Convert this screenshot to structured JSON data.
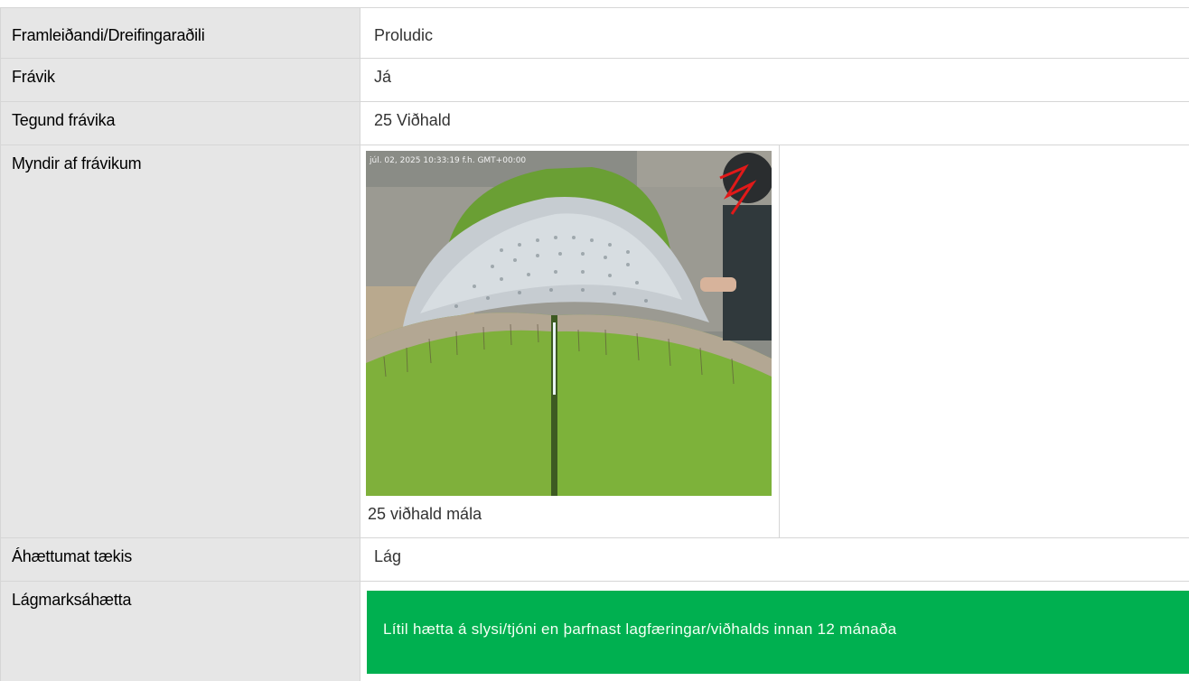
{
  "rows": {
    "manufacturer": {
      "label": "Framleiðandi/Dreifingaraðili",
      "value": "Proludic"
    },
    "deviation": {
      "label": "Frávik",
      "value": "Já"
    },
    "deviation_type": {
      "label": "Tegund frávika",
      "value": "25 Viðhald"
    },
    "deviation_images": {
      "label": "Myndir af frávikum",
      "photo_timestamp": "júl. 02, 2025 10:33:19 f.h. GMT+00:00",
      "caption": "25 viðhald mála"
    },
    "risk_assessment": {
      "label": "Áhættumat tækis",
      "value": "Lág"
    },
    "minimum_risk": {
      "label": "Lágmarksáhætta",
      "banner_text": "Lítil hætta á slysi/tjóni en þarfnast lagfæringar/viðhalds innan 12 mánaða",
      "banner_color": "#00b050"
    }
  }
}
